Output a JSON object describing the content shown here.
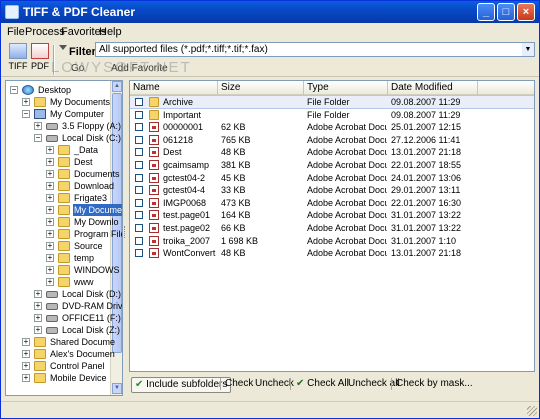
{
  "window": {
    "title": "TIFF & PDF Cleaner"
  },
  "colors": {
    "title_bar": "#0a5ee0",
    "selection": "#316ac5",
    "window_bg": "#ece9d8"
  },
  "menu": [
    "File",
    "Process",
    "Favorites",
    "Help"
  ],
  "toolbar": {
    "tiff_label": "TIFF",
    "pdf_label": "PDF",
    "filter_label": "Filter:",
    "filter_value": "All supported files (*.pdf;*.tiff;*.tif;*.fax)",
    "go_label": "Go",
    "add_favorite_label": "Add Favorite",
    "watermark": "LOWYSOFT.NET"
  },
  "tree": [
    {
      "label": "Desktop",
      "icon": "desktop-icon",
      "expander": "−"
    },
    {
      "label": "My Documents",
      "icon": "folder-icon",
      "expander": "+"
    },
    {
      "label": "My Computer",
      "icon": "computer-icon",
      "expander": "−"
    },
    {
      "label": "3.5 Floppy (A:)",
      "icon": "drive-icon",
      "expander": "+"
    },
    {
      "label": "Local Disk (C:)",
      "icon": "drive-icon",
      "expander": "−"
    },
    {
      "label": "_Data",
      "icon": "folder-icon",
      "expander": "+"
    },
    {
      "label": "Dest",
      "icon": "folder-icon",
      "expander": "+"
    },
    {
      "label": "Documents",
      "icon": "folder-icon",
      "expander": "+"
    },
    {
      "label": "Download",
      "icon": "folder-icon",
      "expander": "+"
    },
    {
      "label": "Frigate3",
      "icon": "folder-icon",
      "expander": "+"
    },
    {
      "label": "My Docume",
      "icon": "folder-icon",
      "expander": "+",
      "selected": true
    },
    {
      "label": "My Downlo",
      "icon": "folder-icon",
      "expander": "+"
    },
    {
      "label": "Program File",
      "icon": "folder-icon",
      "expander": "+"
    },
    {
      "label": "Source",
      "icon": "folder-icon",
      "expander": "+"
    },
    {
      "label": "temp",
      "icon": "folder-icon",
      "expander": "+"
    },
    {
      "label": "WINDOWS",
      "icon": "folder-icon",
      "expander": "+"
    },
    {
      "label": "www",
      "icon": "folder-icon",
      "expander": "+"
    },
    {
      "label": "Local Disk (D:)",
      "icon": "drive-icon",
      "expander": "+"
    },
    {
      "label": "DVD-RAM Driv",
      "icon": "drive-icon",
      "expander": "+"
    },
    {
      "label": "OFFICE11 (F:)",
      "icon": "drive-icon",
      "expander": "+"
    },
    {
      "label": "Local Disk (Z:)",
      "icon": "drive-icon",
      "expander": "+"
    },
    {
      "label": "Shared Docume",
      "icon": "folder-icon",
      "expander": "+"
    },
    {
      "label": "Alex's Documen",
      "icon": "folder-icon",
      "expander": "+"
    },
    {
      "label": "Control Panel",
      "icon": "folder-icon",
      "expander": "+"
    },
    {
      "label": "Mobile Device",
      "icon": "folder-icon",
      "expander": "+"
    }
  ],
  "list": {
    "headers": [
      "Name",
      "Size",
      "Type",
      "Date Modified"
    ],
    "rows": [
      {
        "name": "Archive",
        "size": "",
        "type": "File Folder",
        "date": "09.08.2007 11:29",
        "icon": "folder-icon",
        "selected": true
      },
      {
        "name": "Important",
        "size": "",
        "type": "File Folder",
        "date": "09.08.2007 11:29",
        "icon": "folder-icon"
      },
      {
        "name": "00000001",
        "size": "62 KB",
        "type": "Adobe Acrobat Docu...",
        "date": "25.01.2007 12:15",
        "icon": "pdf-file-icon"
      },
      {
        "name": "061218",
        "size": "765 KB",
        "type": "Adobe Acrobat Docu...",
        "date": "27.12.2006 11:41",
        "icon": "pdf-file-icon"
      },
      {
        "name": "Dest",
        "size": "48 KB",
        "type": "Adobe Acrobat Docu...",
        "date": "13.01.2007 21:18",
        "icon": "pdf-file-icon"
      },
      {
        "name": "gcaimsamp",
        "size": "381 KB",
        "type": "Adobe Acrobat Docu...",
        "date": "22.01.2007 18:55",
        "icon": "pdf-file-icon"
      },
      {
        "name": "gctest04-2",
        "size": "45 KB",
        "type": "Adobe Acrobat Docu...",
        "date": "24.01.2007 13:06",
        "icon": "pdf-file-icon"
      },
      {
        "name": "gctest04-4",
        "size": "33 KB",
        "type": "Adobe Acrobat Docu...",
        "date": "29.01.2007 13:11",
        "icon": "pdf-file-icon"
      },
      {
        "name": "IMGP0068",
        "size": "473 KB",
        "type": "Adobe Acrobat Docu...",
        "date": "22.01.2007 16:30",
        "icon": "pdf-file-icon"
      },
      {
        "name": "test.page01",
        "size": "164 KB",
        "type": "Adobe Acrobat Docu...",
        "date": "31.01.2007 13:22",
        "icon": "pdf-file-icon"
      },
      {
        "name": "test.page02",
        "size": "66 KB",
        "type": "Adobe Acrobat Docu...",
        "date": "31.01.2007 13:22",
        "icon": "pdf-file-icon"
      },
      {
        "name": "troika_2007",
        "size": "1 698 KB",
        "type": "Adobe Acrobat Docu...",
        "date": "31.01.2007 1:10",
        "icon": "pdf-file-icon"
      },
      {
        "name": "WontConvert",
        "size": "48 KB",
        "type": "Adobe Acrobat Docu...",
        "date": "13.01.2007 21:18",
        "icon": "pdf-file-icon"
      }
    ]
  },
  "bottombar": {
    "include_subfolders": "Include subfolders",
    "check": "Check",
    "uncheck": "Uncheck",
    "check_all": "Check All",
    "uncheck_all": "Uncheck all",
    "check_by_mask": "Check by mask..."
  }
}
